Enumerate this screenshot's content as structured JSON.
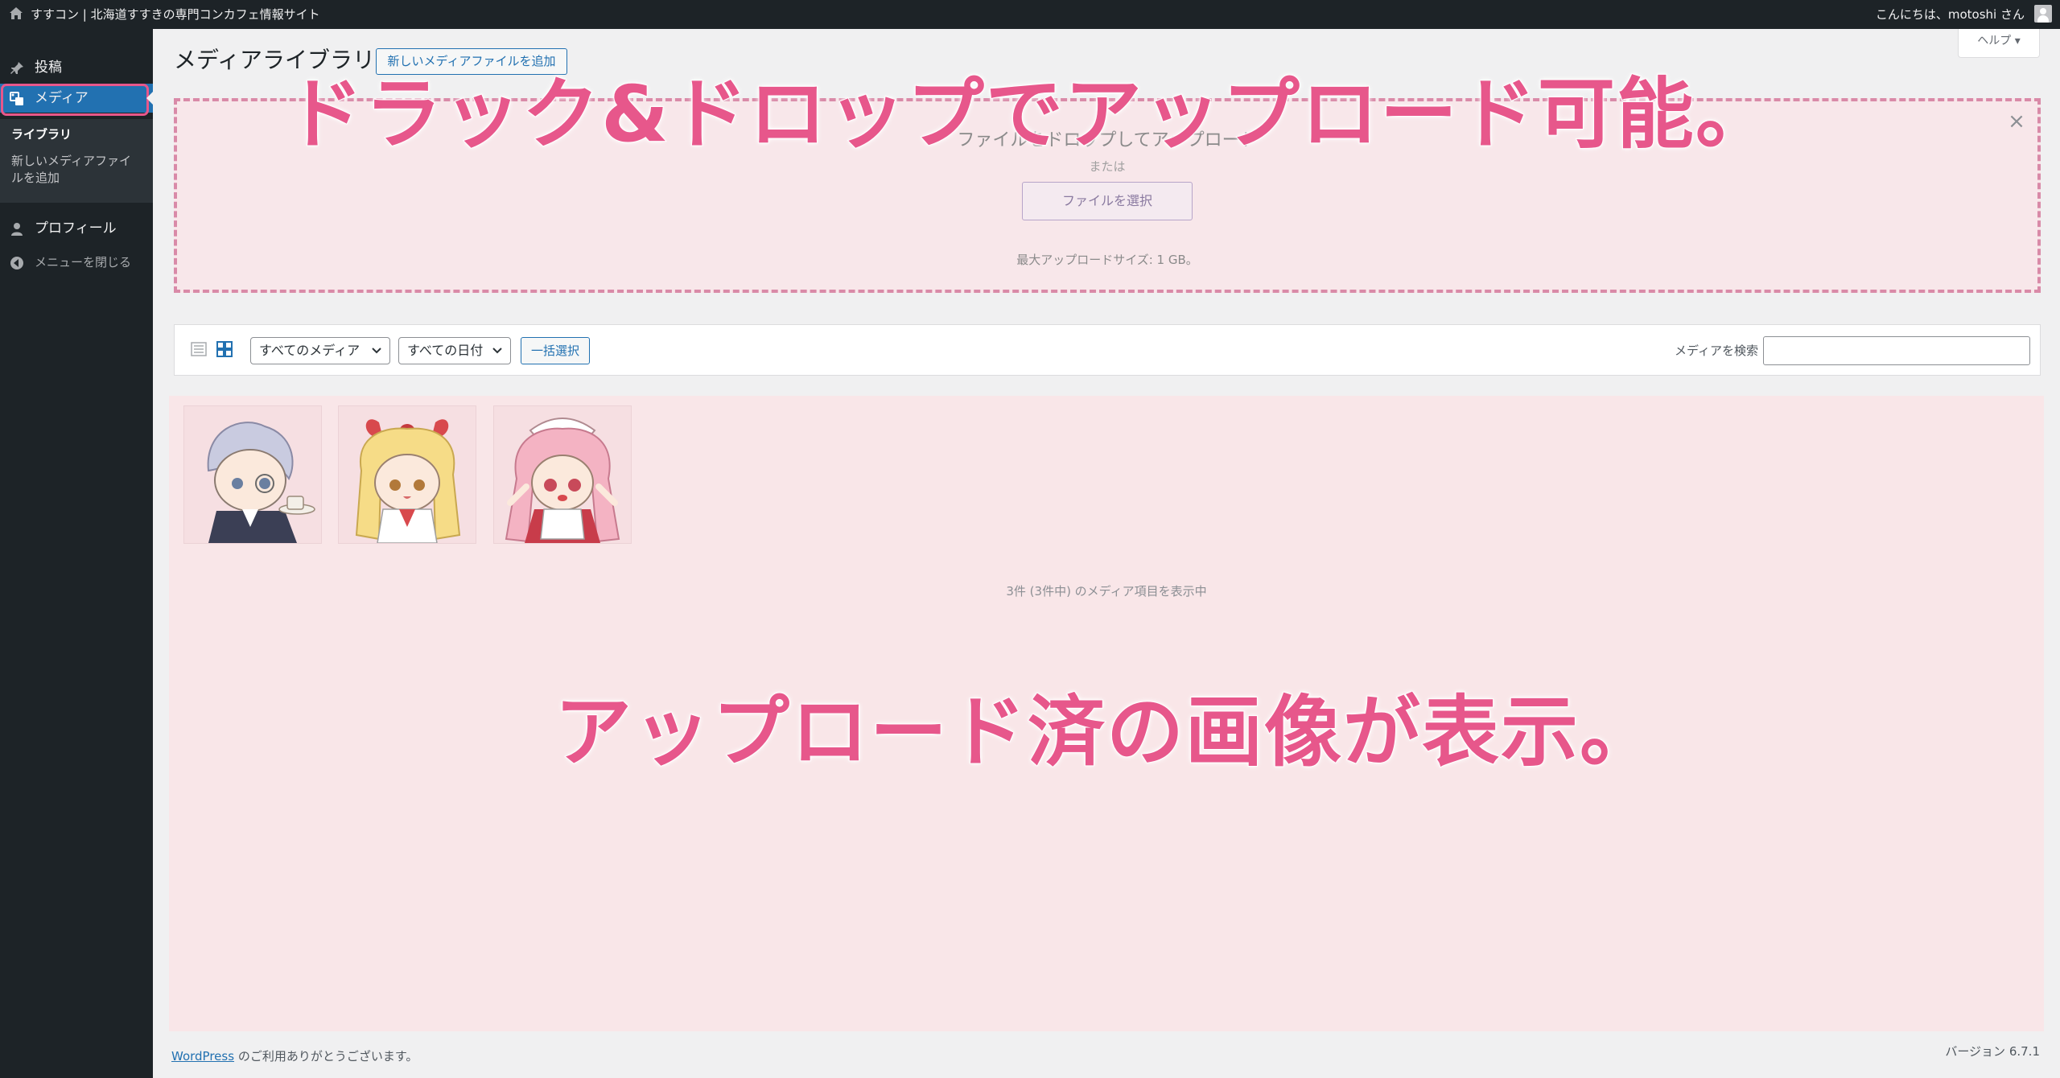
{
  "admin_bar": {
    "site_name": "すすコン | 北海道すすきの専門コンカフェ情報サイト",
    "greeting": "こんにちは、motoshi さん"
  },
  "sidebar": {
    "items": [
      {
        "label": "投稿",
        "icon": "pushpin-icon"
      },
      {
        "label": "メディア",
        "icon": "media-icon"
      },
      {
        "label": "プロフィール",
        "icon": "user-icon"
      },
      {
        "label": "メニューを閉じる",
        "icon": "collapse-icon"
      }
    ],
    "submenu": {
      "library": "ライブラリ",
      "add_new": "新しいメディアファイルを追加"
    }
  },
  "header": {
    "title": "メディアライブラリ",
    "add_button": "新しいメディアファイルを追加",
    "help": "ヘルプ ▾"
  },
  "dropzone": {
    "title": "ファイルをドロップしてアップロード",
    "or": "または",
    "select_button": "ファイルを選択",
    "max_size": "最大アップロードサイズ: 1 GB。"
  },
  "toolbar": {
    "filter_media": "すべてのメディア",
    "filter_date": "すべての日付",
    "bulk_select": "一括選択",
    "search_label": "メディアを検索",
    "search_value": ""
  },
  "media": {
    "items": [
      {
        "alt": "chibi-character-butler"
      },
      {
        "alt": "chibi-character-blonde"
      },
      {
        "alt": "chibi-character-maid"
      }
    ],
    "count_text": "3件 (3件中) のメディア項目を表示中"
  },
  "annotations": {
    "top": "ドラック&ドロップでアップロード可能。",
    "bottom": "アップロード済の画像が表示。"
  },
  "footer": {
    "wordpress_link": "WordPress",
    "thanks": " のご利用ありがとうございます。",
    "version": "バージョン 6.7.1"
  },
  "colors": {
    "admin_dark": "#1d2327",
    "wp_blue": "#2271b1",
    "annotation_pink": "#e7578b",
    "overlay_tint": "#f9e6e8"
  }
}
